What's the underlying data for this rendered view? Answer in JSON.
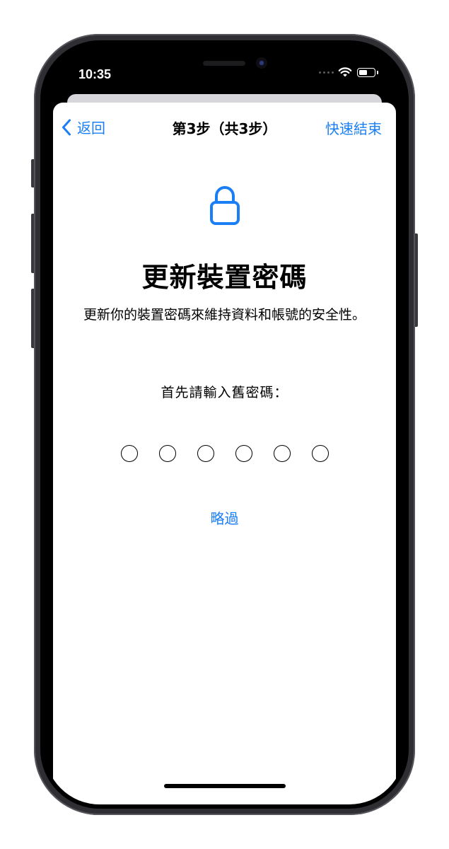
{
  "status_bar": {
    "time": "10:35",
    "signal_icon": "signal-dots-icon",
    "wifi_icon": "wifi-icon",
    "battery_icon": "battery-icon"
  },
  "nav": {
    "back_label": "返回",
    "back_icon": "chevron-left-icon",
    "title": "第3步（共3步）",
    "done_label": "快速結束"
  },
  "main": {
    "icon": "lock-icon",
    "title": "更新裝置密碼",
    "description": "更新你的裝置密碼來維持資料和帳號的安全性。",
    "prompt": "首先請輸入舊密碼：",
    "passcode_digits": 6,
    "passcode_filled": 0,
    "skip_label": "略過"
  },
  "colors": {
    "accent": "#1a7ef5",
    "text": "#000000",
    "background": "#ffffff",
    "device_frame": "#2e2e33"
  }
}
